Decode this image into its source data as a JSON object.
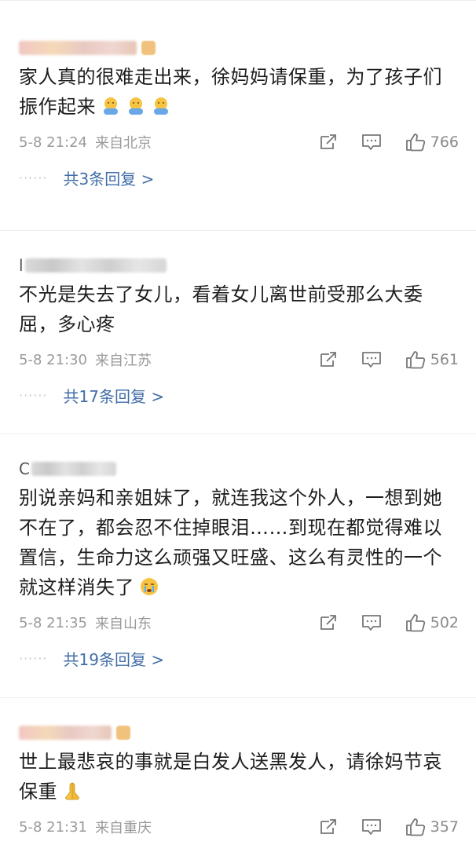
{
  "comments": [
    {
      "user_initial": "",
      "text": "家人真的很难走出来，徐妈妈请保重，为了孩子们振作起来",
      "time": "5-8 21:24",
      "location": "来自北京",
      "likes": "766",
      "replies": {
        "prefix": "······",
        "label": "共3条回复 >"
      },
      "emoji": [
        "hug-emoji",
        "hug-emoji",
        "hug-emoji"
      ]
    },
    {
      "user_initial": "l",
      "text": "不光是失去了女儿，看着女儿离世前受那么大委屈，多心疼",
      "time": "5-8 21:30",
      "location": "来自江苏",
      "likes": "561",
      "replies": {
        "prefix": "······",
        "label": "共17条回复 >"
      }
    },
    {
      "user_initial": "C",
      "text": "别说亲妈和亲姐妹了，就连我这个外人，一想到她不在了，都会忍不住掉眼泪……到现在都觉得难以置信，生命力这么顽强又旺盛、这么有灵性的一个就这样消失了",
      "time": "5-8 21:35",
      "location": "来自山东",
      "likes": "502",
      "replies": {
        "prefix": "······",
        "label": "共19条回复 >"
      },
      "emoji": [
        "crying-emoji"
      ]
    },
    {
      "user_initial": "",
      "text": "世上最悲哀的事就是白发人送黑发人，请徐妈节哀保重",
      "time": "5-8 21:31",
      "location": "来自重庆",
      "likes": "357",
      "emoji": [
        "pray-emoji"
      ]
    }
  ],
  "icons": {
    "share": "share-icon",
    "comment": "comment-icon",
    "like": "thumbs-up-icon"
  },
  "colors": {
    "reply_link": "#426ea8",
    "meta_text": "#9a9a9a"
  }
}
